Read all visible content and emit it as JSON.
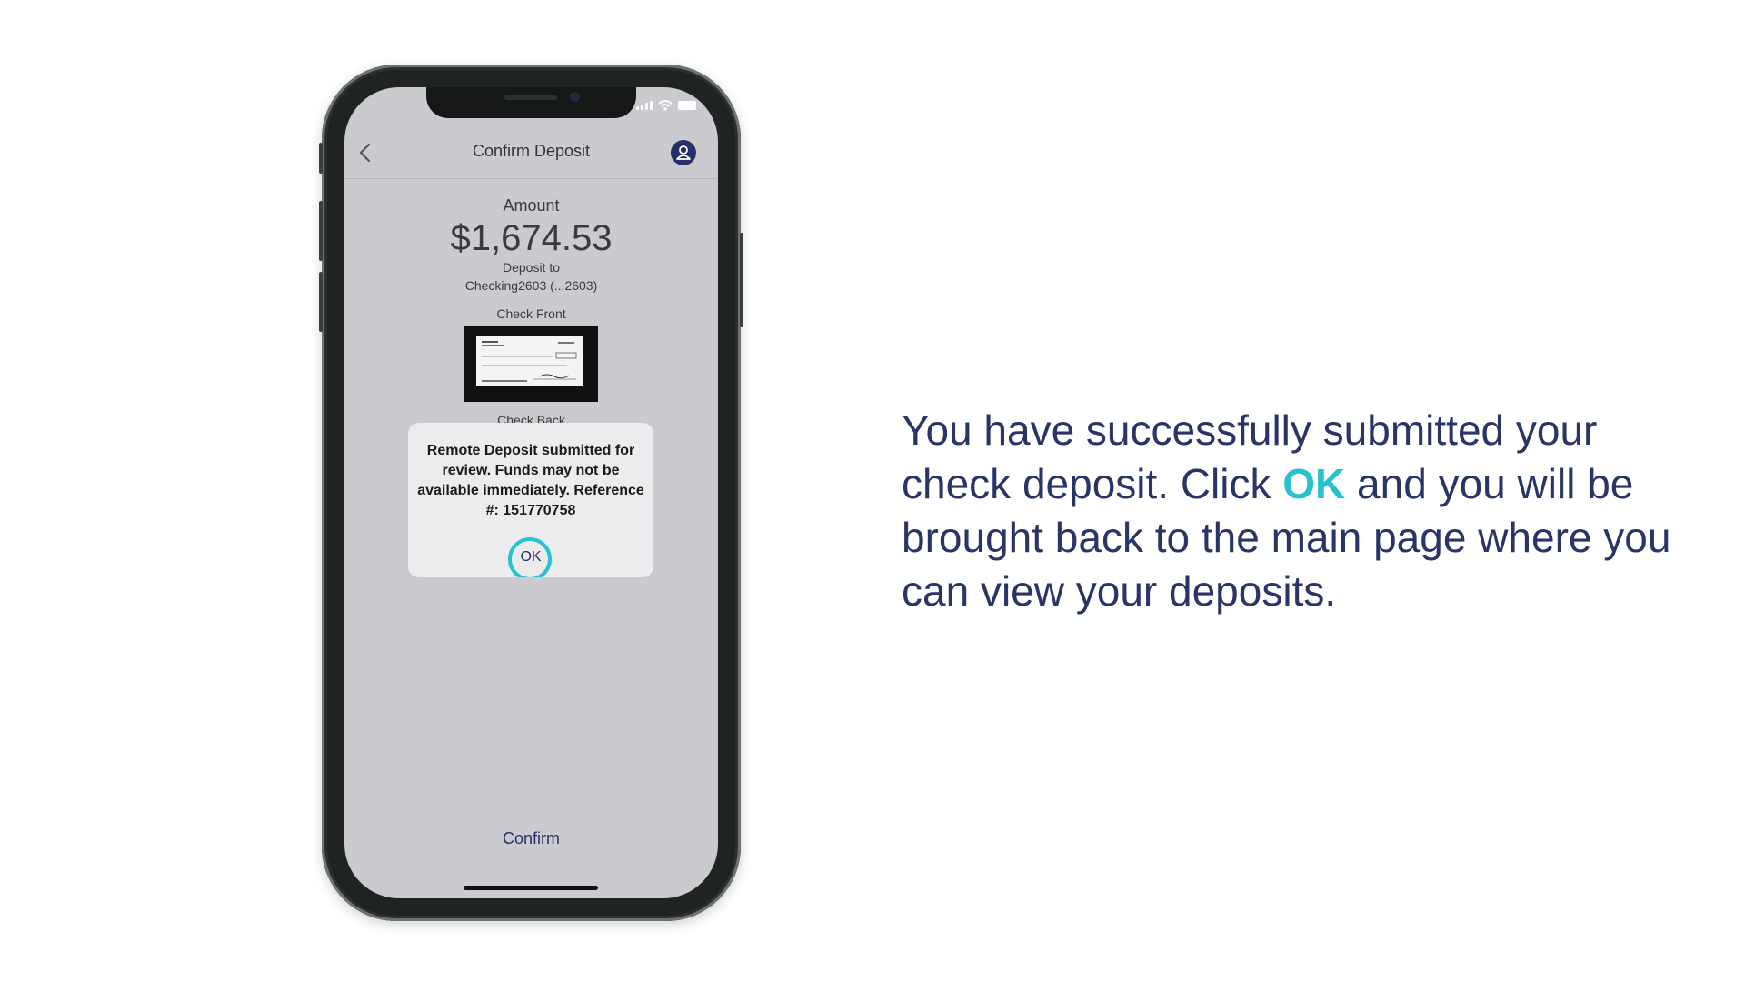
{
  "nav": {
    "title": "Confirm Deposit",
    "back_icon": "chevron-left-icon",
    "profile_icon": "user-icon"
  },
  "deposit": {
    "amount_label": "Amount",
    "amount": "$1,674.53",
    "deposit_to_label": "Deposit to",
    "account": "Checking2603 (...2603)",
    "check_front_label": "Check Front",
    "check_back_label": "Check Back"
  },
  "alert": {
    "message": "Remote Deposit submitted for review. Funds may not be available immediately. Reference #: 151770758",
    "ok_label": "OK"
  },
  "footer": {
    "confirm_label": "Confirm"
  },
  "instruction": {
    "before": "You have successfully submitted your check deposit. Click ",
    "highlight": "OK",
    "after": " and you will be brought back to the main page where you can view your deposits."
  },
  "colors": {
    "accent": "#28c1cf",
    "brand_navy": "#25306a",
    "screen_background": "#cbcbcf"
  }
}
